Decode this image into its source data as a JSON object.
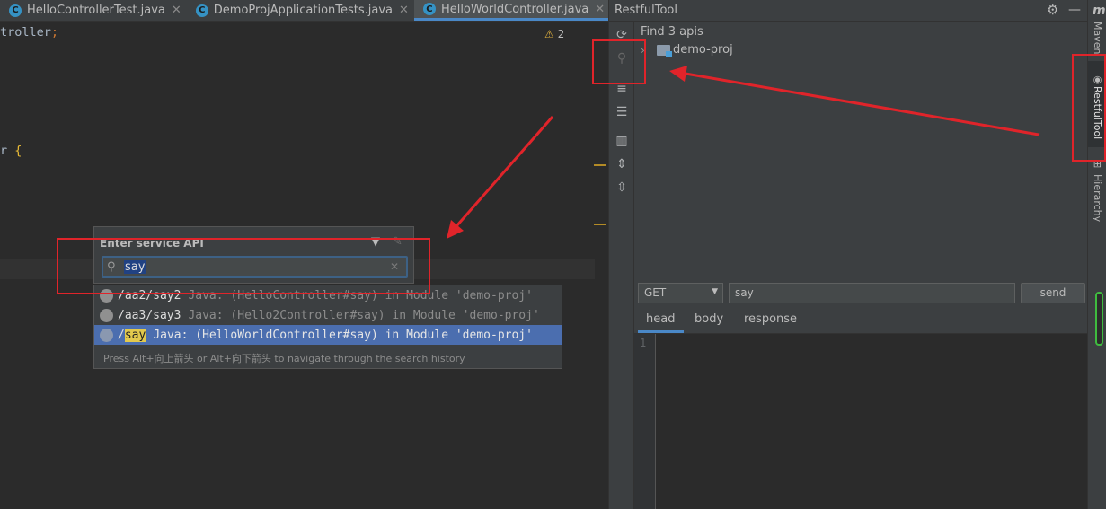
{
  "editor": {
    "tabs": [
      {
        "label": "HelloControllerTest.java",
        "active": false
      },
      {
        "label": "DemoProjApplicationTests.java",
        "active": false
      },
      {
        "label": "HelloWorldController.java",
        "active": true
      }
    ],
    "code_line1": "troller",
    "code_line1_semi": ";",
    "code_line2": "r ",
    "code_line2_brace": "{",
    "warning_count": "2"
  },
  "popup": {
    "title": "Enter service API",
    "query": "say",
    "results": [
      {
        "path": "/aa2/say2",
        "description": "Java: (HelloController#say) in Module 'demo-proj'"
      },
      {
        "path": "/aa3/say3",
        "description": "Java: (Hello2Controller#say) in Module 'demo-proj'"
      },
      {
        "path_prefix": "/",
        "path_match": "say",
        "description": "Java: (HelloWorldController#say) in Module 'demo-proj'"
      }
    ],
    "hint": "Press Alt+向上箭头 or Alt+向下箭头 to navigate through the search history"
  },
  "toolwindow": {
    "title": "RestfulTool",
    "found": "Find 3 apis",
    "tree_root": "demo-proj",
    "method": "GET",
    "url": "say",
    "send_label": "send",
    "tabs": [
      "head",
      "body",
      "response"
    ],
    "line_number": "1"
  },
  "sidebar": {
    "maven": "Maven",
    "restfultool": "RestfulTool",
    "hierarchy": "Hierarchy"
  },
  "colors": {
    "annotation_red": "#e0242a",
    "selection_blue": "#4b6eaf",
    "match_highlight": "#e2c94d"
  }
}
